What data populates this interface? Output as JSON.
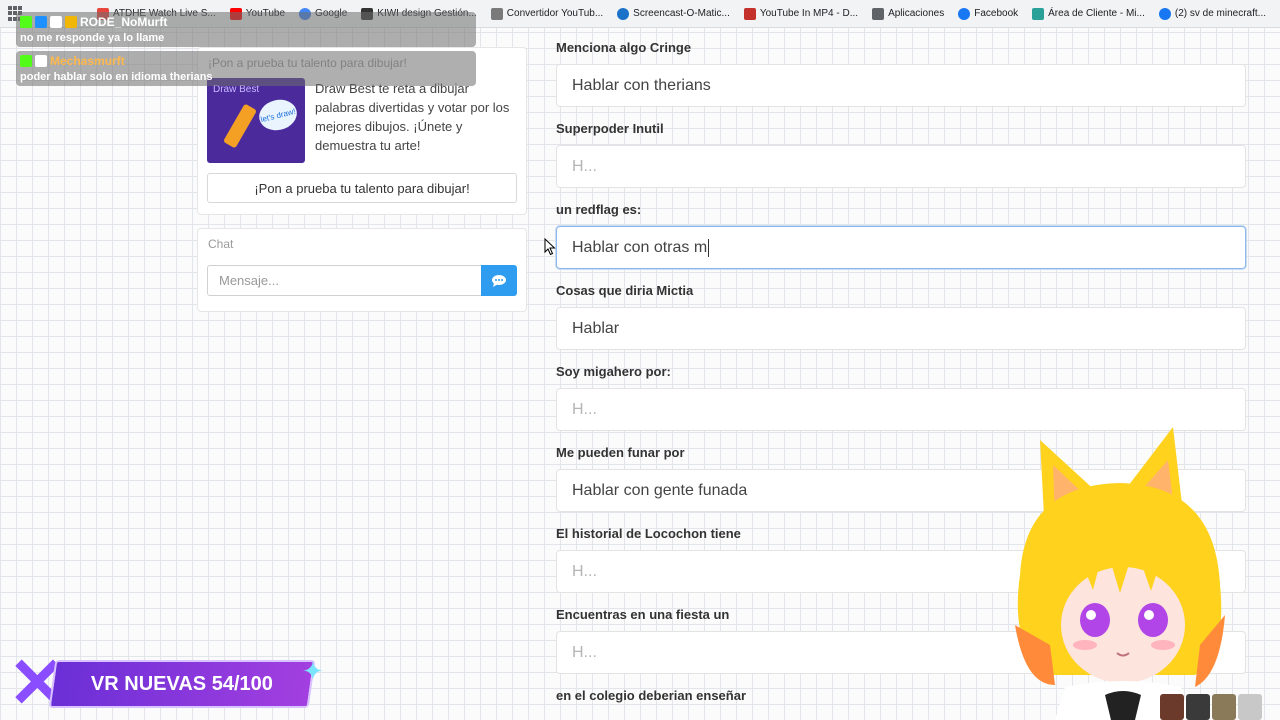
{
  "bookmarks": [
    {
      "label": "ATDHE Watch Live S...",
      "color": "#e8453c"
    },
    {
      "label": "YouTube",
      "color": "#ff0000"
    },
    {
      "label": "Google",
      "color": "#4285f4"
    },
    {
      "label": "KIWI design Gestión...",
      "color": "#333333"
    },
    {
      "label": "Convertidor YouTub...",
      "color": "#7a7a7a"
    },
    {
      "label": "Screencast-O-Matic...",
      "color": "#1a73c8"
    },
    {
      "label": "YouTube In MP4 - D...",
      "color": "#c4302b"
    },
    {
      "label": "Aplicaciones",
      "color": "#5f6368"
    },
    {
      "label": "Facebook",
      "color": "#1877f2"
    },
    {
      "label": "Área de Cliente - Mi...",
      "color": "#2aa198"
    },
    {
      "label": "(2) sv de minecraft...",
      "color": "#1877f2"
    }
  ],
  "chat_overlay": {
    "messages": [
      {
        "user": "RODE_NoMurft",
        "user_color": "#ffffff",
        "text": "no me responde ya lo llame"
      },
      {
        "user": "Mechasmurft",
        "user_color": "#ffb84d",
        "text": "poder hablar solo en idioma therians"
      }
    ]
  },
  "promo": {
    "title": "¡Pon a prueba tu talento para dibujar!",
    "image_label": "Draw Best",
    "image_badge": "let's draw!",
    "description": "Draw Best te reta a dibujar palabras divertidas y votar por los mejores dibujos. ¡Únete y demuestra tu arte!",
    "button": "¡Pon a prueba tu talento para dibujar!"
  },
  "chat": {
    "title": "Chat",
    "placeholder": "Mensaje..."
  },
  "form": {
    "questions": [
      {
        "label": "Menciona algo Cringe",
        "value": "Hablar con therians",
        "placeholder": false
      },
      {
        "label": "Superpoder Inutil",
        "value": "H...",
        "placeholder": true
      },
      {
        "label": "un redflag es:",
        "value": "Hablar con otras m",
        "placeholder": false,
        "focused": true
      },
      {
        "label": "Cosas que diria Mictia",
        "value": "Hablar",
        "placeholder": false
      },
      {
        "label": "Soy migahero por:",
        "value": "H...",
        "placeholder": true
      },
      {
        "label": "Me pueden funar por",
        "value": "Hablar con gente funada",
        "placeholder": false
      },
      {
        "label": "El historial de Locochon tiene",
        "value": "H...",
        "placeholder": true
      },
      {
        "label": "Encuentras en una fiesta un",
        "value": "H...",
        "placeholder": true
      },
      {
        "label": "en el colegio deberian enseñar",
        "value": "",
        "placeholder": true
      }
    ]
  },
  "banner": {
    "text": "VR NUEVAS 54/100"
  },
  "colors": {
    "send_button": "#2e9df0",
    "focus_border": "#8fb8ea",
    "banner_purple": "#6a2fd6",
    "avatar_hair": "#ffd21e"
  }
}
